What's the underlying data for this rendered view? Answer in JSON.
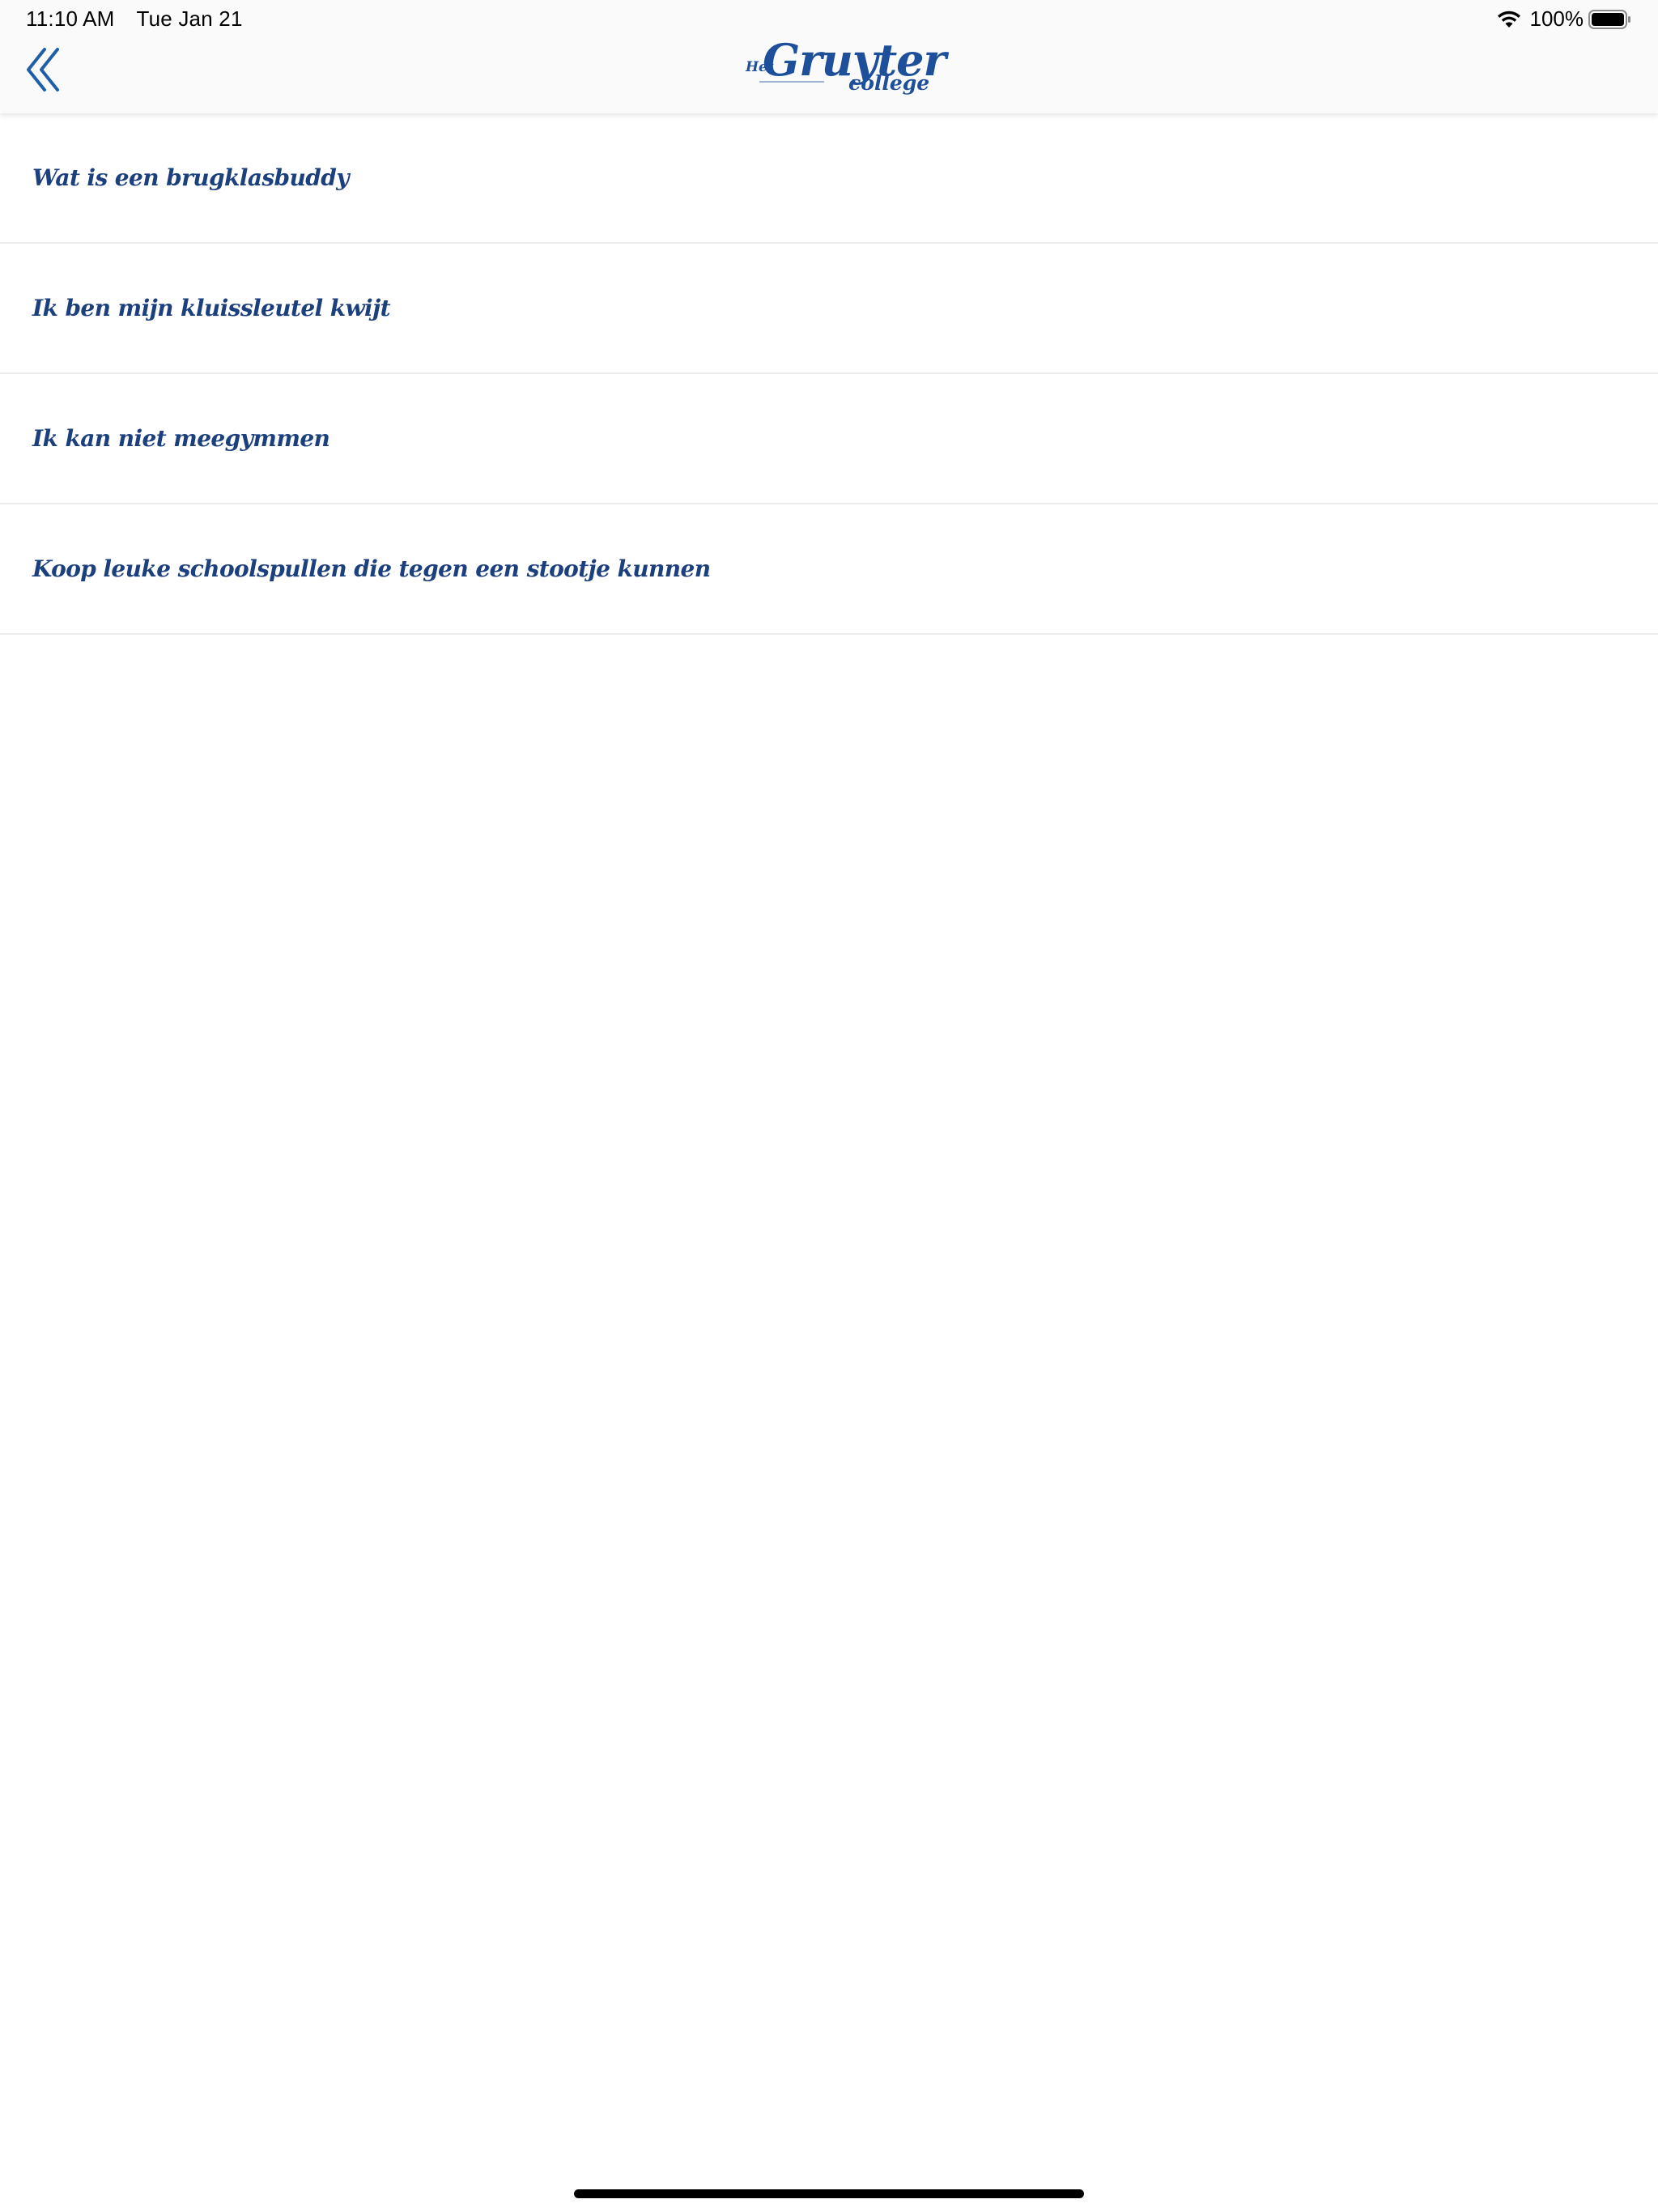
{
  "status_bar": {
    "time": "11:10 AM",
    "date": "Tue Jan 21",
    "battery_percent": "100%",
    "wifi_icon": "wifi-icon",
    "battery_icon": "battery-icon"
  },
  "nav": {
    "back_icon": "double-chevron-left-icon",
    "logo": {
      "prefix": "Het",
      "name": "Gruyter",
      "suffix": "college"
    }
  },
  "list": {
    "items": [
      {
        "label": "Wat is een brugklasbuddy"
      },
      {
        "label": "Ik ben mijn kluissleutel kwijt"
      },
      {
        "label": "Ik kan niet meegymmen"
      },
      {
        "label": "Koop leuke schoolspullen die tegen een stootje kunnen"
      }
    ]
  },
  "colors": {
    "brand_blue": "#1d4f9b",
    "text_blue": "#1c3f7e",
    "bar_background": "#fafafa",
    "divider": "#ececec"
  }
}
